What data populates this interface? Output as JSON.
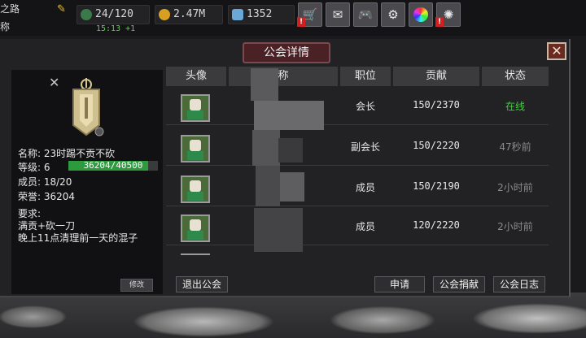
{
  "topbar": {
    "player_fragment_1": "之路",
    "player_fragment_2": "称",
    "stamina": "24/120",
    "timer": "15:13 +1",
    "gold": "2.47M",
    "gems": "1352",
    "buttons": [
      {
        "icon": "shop-cart-icon",
        "badge": "!"
      },
      {
        "icon": "mail-icon",
        "badge": ""
      },
      {
        "icon": "gamepad-icon",
        "badge": ""
      },
      {
        "icon": "gear-icon",
        "badge": ""
      },
      {
        "icon": "color-wheel-icon",
        "badge": ""
      },
      {
        "icon": "firework-icon",
        "badge": "!"
      }
    ]
  },
  "dialog": {
    "title": "公会详情",
    "close_label": "✕"
  },
  "guild": {
    "name_label": "名称: 23时踢不贡不砍",
    "level_label": "等级: 6",
    "exp": "36204/40500",
    "exp_fraction": 0.894,
    "members_label": "成员: 18/20",
    "honor_label": "荣誉: 36204",
    "requirements_title": "要求:",
    "requirement_1": "满贡+砍一刀",
    "requirement_2": "晚上11点清理前一天的混子",
    "edit_button": "修改"
  },
  "table": {
    "headers": [
      "头像",
      "称",
      "职位",
      "贡献",
      "状态"
    ],
    "rows": [
      {
        "position": "会长",
        "contribution": "150/2370",
        "status": "在线",
        "status_color": "#3ed13e"
      },
      {
        "position": "副会长",
        "contribution": "150/2220",
        "status": "47秒前",
        "status_color": "#8a8a8a"
      },
      {
        "position": "成员",
        "contribution": "150/2190",
        "status": "2小时前",
        "status_color": "#8a8a8a"
      },
      {
        "position": "成员",
        "contribution": "120/2220",
        "status": "2小时前",
        "status_color": "#8a8a8a"
      }
    ]
  },
  "actions": {
    "leave": "退出公会",
    "apply": "申请",
    "donate": "公会捐献",
    "log": "公会日志"
  }
}
